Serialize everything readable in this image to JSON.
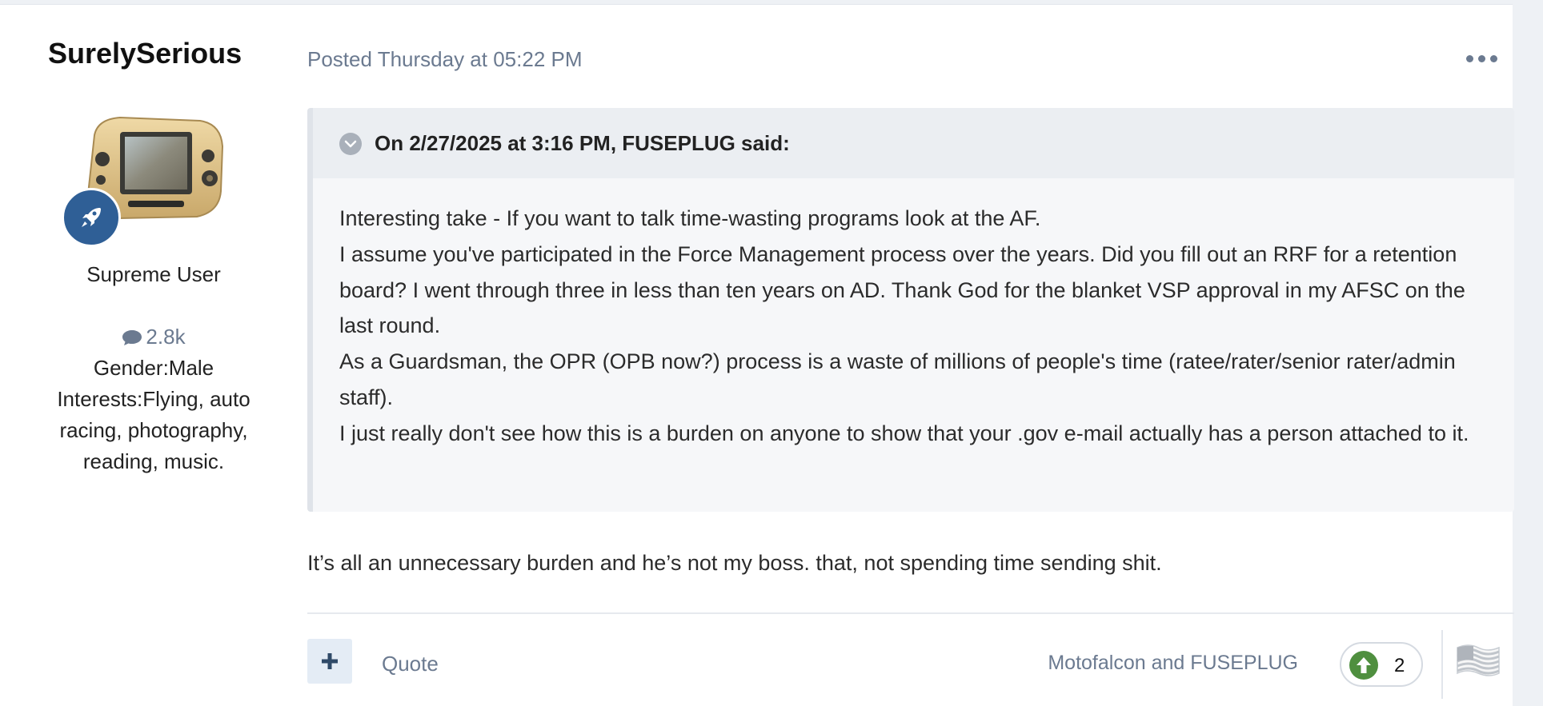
{
  "author": {
    "name": "SurelySerious",
    "title": "Supreme User",
    "post_count": "2.8k",
    "gender_field": "Gender:Male",
    "interests_field": "Interests:Flying, auto racing, photography, reading, music."
  },
  "post": {
    "meta": "Posted Thursday at 05:22 PM",
    "quote": {
      "cite": "On 2/27/2025 at 3:16 PM, FUSEPLUG said:",
      "lines": [
        "Interesting take - If you want to talk time-wasting programs look at the AF.",
        "I assume you've participated in the Force Management process over the years. Did you fill out an RRF for a retention board? I went through three in less than ten years on AD. Thank God for the blanket VSP approval in my AFSC on the last round.",
        "As a Guardsman, the OPR (OPB now?) process is a waste of millions of people's time (ratee/rater/senior rater/admin staff).",
        "I just really don't see how this is a burden on anyone to show that your .gov e-mail actually has a person attached to it."
      ]
    },
    "body": "It’s all an unnecessary burden and he’s not my boss. that, not spending time sending shit."
  },
  "footer": {
    "multiquote_icon": "plus-icon",
    "quote_label": "Quote",
    "reaction_users": "Motofalcon and FUSEPLUG",
    "reaction_icon": "upvote-icon",
    "reaction_count": "2",
    "reaction_trigger_icon": "us-flag-icon"
  },
  "colors": {
    "accent": "#2f5f96",
    "muted_text": "#6b7a90",
    "upvote": "#4f8f3f",
    "quote_bg": "#f6f7f9",
    "quote_header_bg": "#ebeef2"
  }
}
